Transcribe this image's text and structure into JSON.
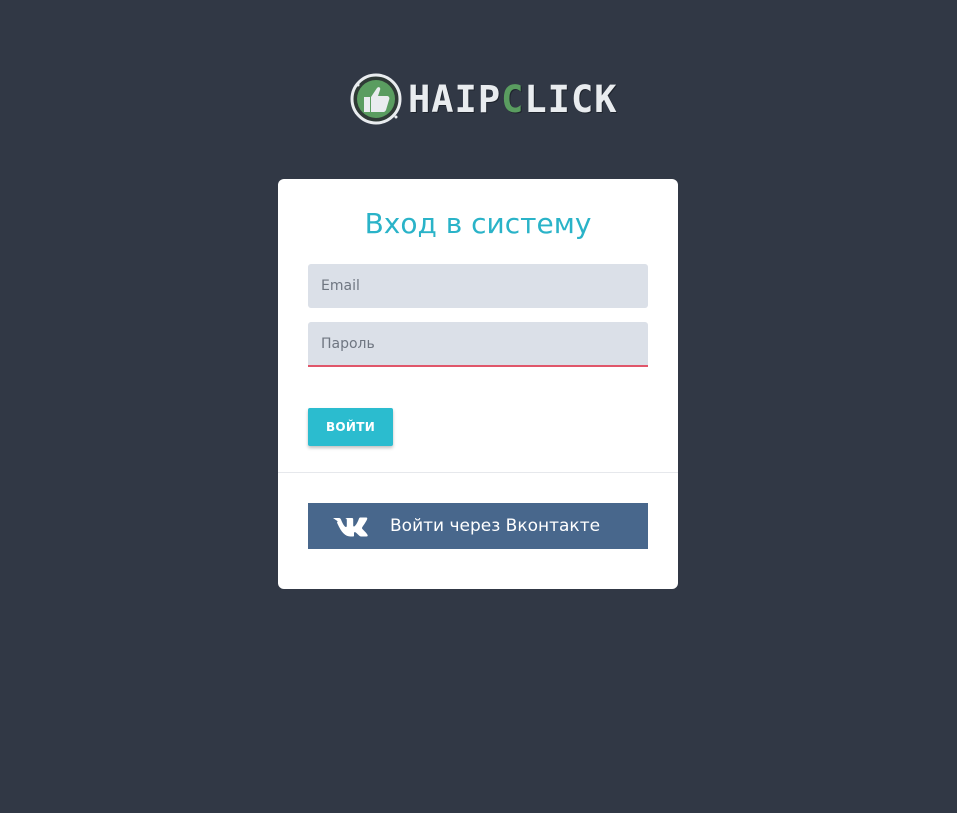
{
  "logo": {
    "text_before": "HAIP",
    "text_accent": "C",
    "text_after": "LICK"
  },
  "colors": {
    "background": "#313845",
    "card": "#ffffff",
    "accent": "#2bbccf",
    "title": "#2ab3c8",
    "vk_brand": "#48678c",
    "error_underline": "#e0566a",
    "logo_accent": "#5a9d60"
  },
  "login_form": {
    "title": "Вход в систему",
    "email_placeholder": "Email",
    "email_value": "",
    "password_placeholder": "Пароль",
    "password_value": "",
    "submit_label": "ВОЙТИ"
  },
  "social_login": {
    "vk_icon": "vk-logo-icon",
    "vk_label": "Войти через Вконтакте"
  }
}
